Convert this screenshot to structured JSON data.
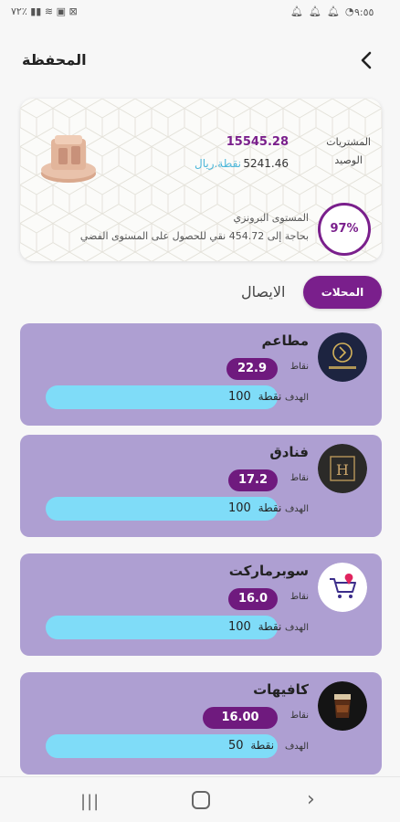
{
  "status_bar": {
    "time": "٩:٥٥",
    "battery": "٧٢٪",
    "notification_icons": [
      "whatsapp-icon",
      "bell-icon",
      "bell-icon",
      "bell-icon"
    ]
  },
  "header": {
    "title": "المحفظة",
    "back_icon": "chevron-left-icon"
  },
  "wallet": {
    "purchases_label": "المشتريات",
    "balance_label": "الوصيد",
    "purchases_value": "15545.28",
    "balance_value": "5241.46",
    "balance_unit": "نقطة.ريال",
    "level_percent": "97%",
    "level_percent_value": 97,
    "level_name": "المستوى البرونزي",
    "level_need": "بحاجة إلى 454.72 نقي للحصول على المستوى الفضي",
    "medal_icon": "bronze-medal-icon"
  },
  "tabs": {
    "stores": "المحلات",
    "receipts": "الايصال"
  },
  "categories": [
    {
      "name": "مطاعم",
      "points_label": "نقاط",
      "points": "22.9",
      "goal_label": "الهدف",
      "goal_value": "100",
      "goal_unit": "نقطة",
      "icon": "restaurant-logo-icon"
    },
    {
      "name": "فنادق",
      "points_label": "نقاط",
      "points": "17.2",
      "goal_label": "الهدف",
      "goal_value": "100",
      "goal_unit": "نقطة",
      "icon": "hotel-logo-icon"
    },
    {
      "name": "سوبرماركت",
      "points_label": "نقاط",
      "points": "16.0",
      "goal_label": "الهدف",
      "goal_value": "100",
      "goal_unit": "نقطة",
      "icon": "shopping-cart-icon"
    },
    {
      "name": "كافيهات",
      "points_label": "نقاط",
      "points": "16.00",
      "goal_label": "الهدف",
      "goal_value": "50",
      "goal_unit": "نقطة",
      "icon": "coffee-cup-icon"
    }
  ],
  "colors": {
    "brand_purple": "#7a1f8c",
    "card_lavender": "#ae9fd2",
    "goal_cyan": "#7fdcf8",
    "points_pill": "#6f1a7e"
  }
}
